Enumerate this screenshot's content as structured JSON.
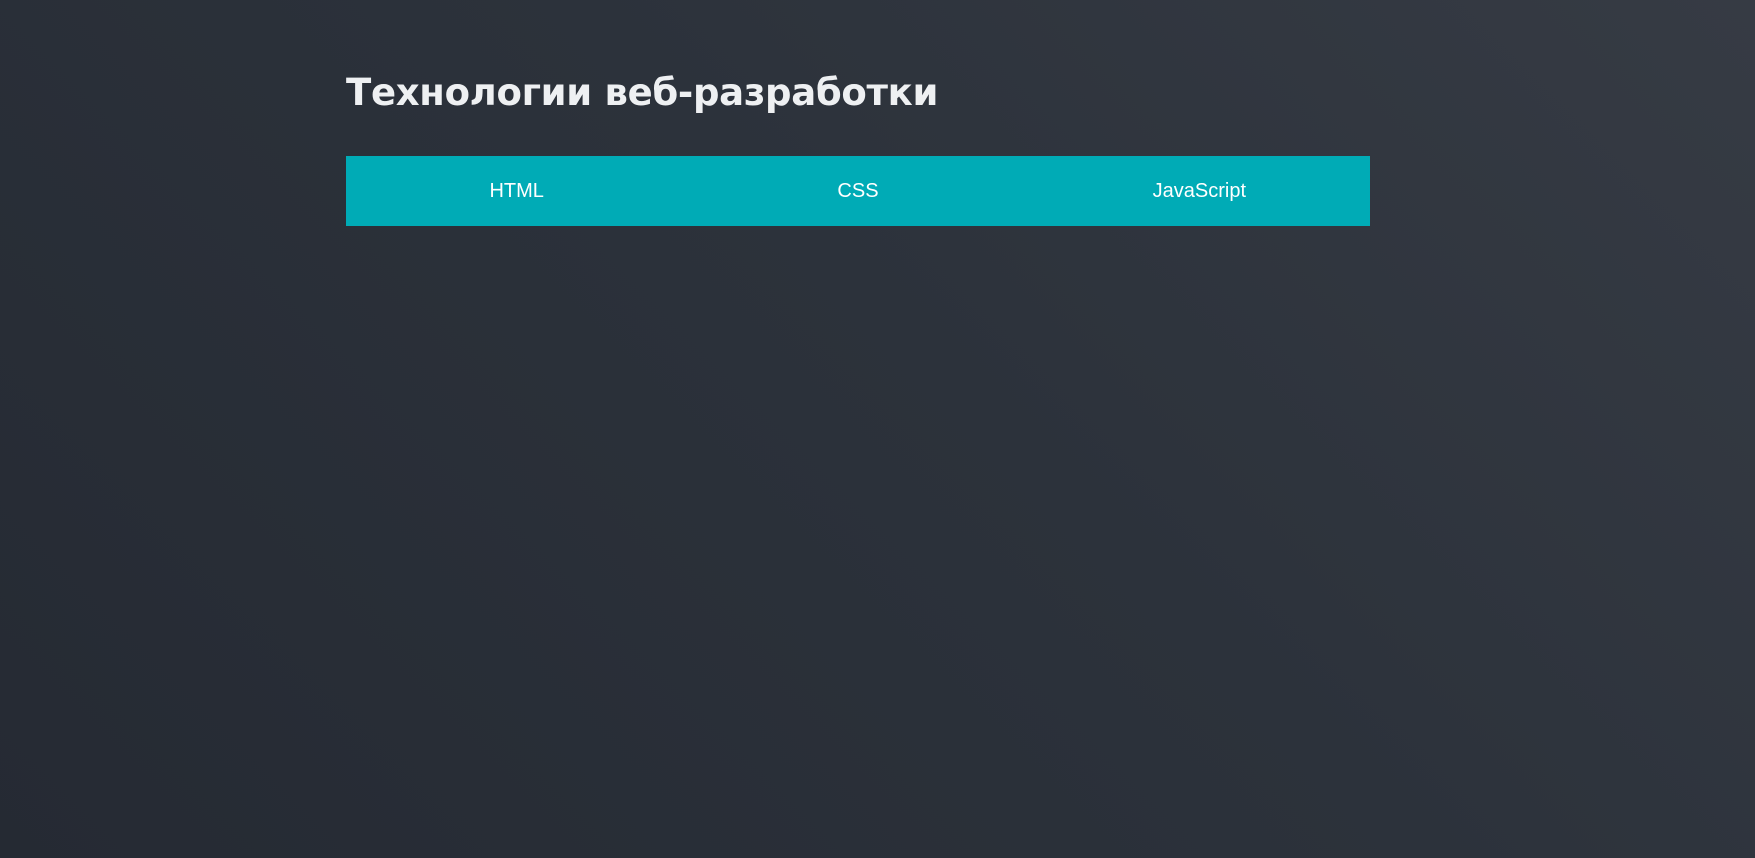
{
  "page": {
    "title": "Технологии веб-разработки"
  },
  "tabs": [
    {
      "label": "HTML"
    },
    {
      "label": "CSS"
    },
    {
      "label": "JavaScript"
    }
  ],
  "colors": {
    "background": "#2c323b",
    "tab_bar": "#00abb6",
    "title_text": "#eef0f2",
    "tab_text": "#ffffff"
  }
}
